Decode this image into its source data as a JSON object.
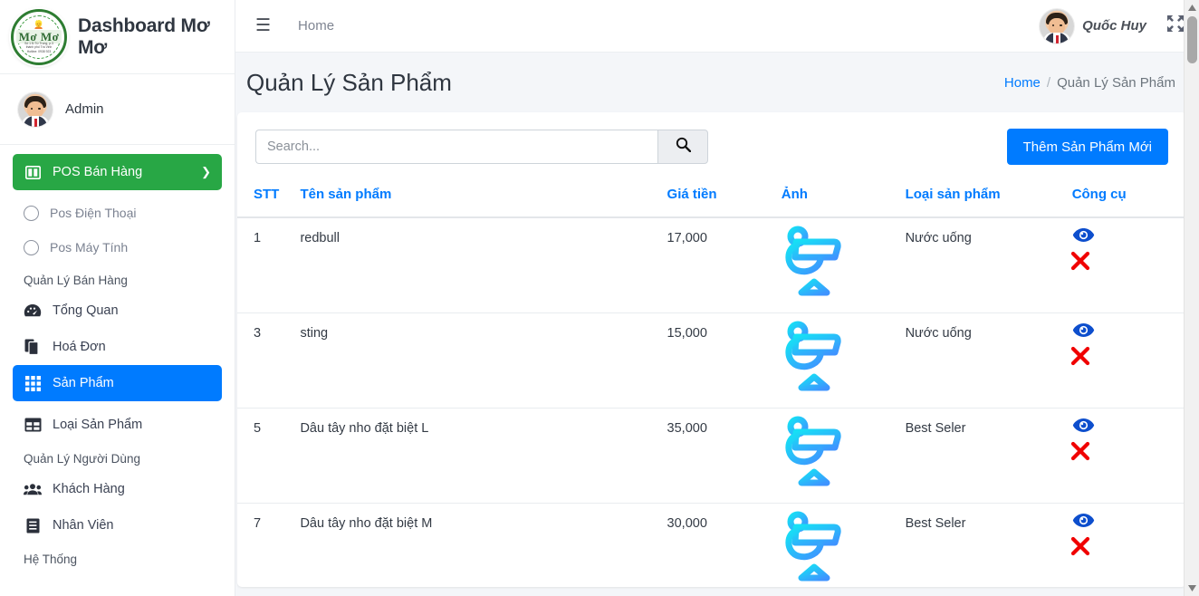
{
  "brand": {
    "logo_text": "Mơ Mơ",
    "logo_sub": "Số 1 Đ.Từ Trọng, phường 3\nthành phố Trà Vinh\nHotline: 0938 923",
    "title": "Dashboard Mơ Mơ",
    "logo_icon": "shop-logo-icon"
  },
  "sidebar": {
    "user": {
      "name": "Admin",
      "avatar_icon": "avatar-icon"
    },
    "pos_button": {
      "label": "POS Bán Hàng",
      "icon": "columns-icon",
      "chevron": "chevron-down-icon",
      "color": "#28a745"
    },
    "pos_children": [
      {
        "label": "Pos Điện Thoại",
        "icon": "circle-o-icon"
      },
      {
        "label": "Pos Máy Tính",
        "icon": "circle-o-icon"
      }
    ],
    "section_sales": "Quản Lý Bán Hàng",
    "sales_items": [
      {
        "label": "Tổng Quan",
        "icon": "tachometer-icon"
      },
      {
        "label": "Hoá Đơn",
        "icon": "copy-file-icon"
      },
      {
        "label": "Sản Phẩm",
        "icon": "grid-icon",
        "active": true
      },
      {
        "label": "Loại Sản Phẩm",
        "icon": "table-icon"
      }
    ],
    "section_users": "Quản Lý Người Dùng",
    "user_items": [
      {
        "label": "Khách Hàng",
        "icon": "users-icon"
      },
      {
        "label": "Nhân Viên",
        "icon": "book-icon"
      }
    ],
    "section_system": "Hệ Thống",
    "active_color": "#007bff"
  },
  "topbar": {
    "menu_icon": "hamburger-icon",
    "home_label": "Home",
    "user_name": "Quốc Huy",
    "user_avatar_icon": "avatar-icon",
    "expand_icon": "expand-arrows-icon"
  },
  "page": {
    "title": "Quản Lý Sản Phẩm",
    "breadcrumb_home": "Home",
    "breadcrumb_sep": "/",
    "breadcrumb_current": "Quản Lý Sản Phẩm"
  },
  "toolbar": {
    "search_placeholder": "Search...",
    "search_value": "",
    "search_icon": "search-icon",
    "add_label": "Thêm Sản Phẩm Mới",
    "add_color": "#007bff"
  },
  "table": {
    "columns": [
      "STT",
      "Tên sản phẩm",
      "Giá tiền",
      "Ảnh",
      "Loại sản phẩm",
      "Công cụ"
    ],
    "header_color": "#007bff",
    "row_image_icon": "cocktail-glass-icon",
    "view_icon": "eye-icon",
    "delete_icon": "x-mark-icon",
    "view_color": "#0d4ecd",
    "delete_color": "#f00000",
    "rows": [
      {
        "stt": "1",
        "name": "redbull",
        "price": "17,000",
        "type": "Nước uống"
      },
      {
        "stt": "3",
        "name": "sting",
        "price": "15,000",
        "type": "Nước uống"
      },
      {
        "stt": "5",
        "name": "Dâu tây nho đặt biệt L",
        "price": "35,000",
        "type": "Best Seler"
      },
      {
        "stt": "7",
        "name": "Dâu tây nho đặt biệt M",
        "price": "30,000",
        "type": "Best Seler"
      }
    ]
  },
  "scrollbar": {
    "up_icon": "caret-up-icon",
    "down_icon": "caret-down-icon"
  }
}
